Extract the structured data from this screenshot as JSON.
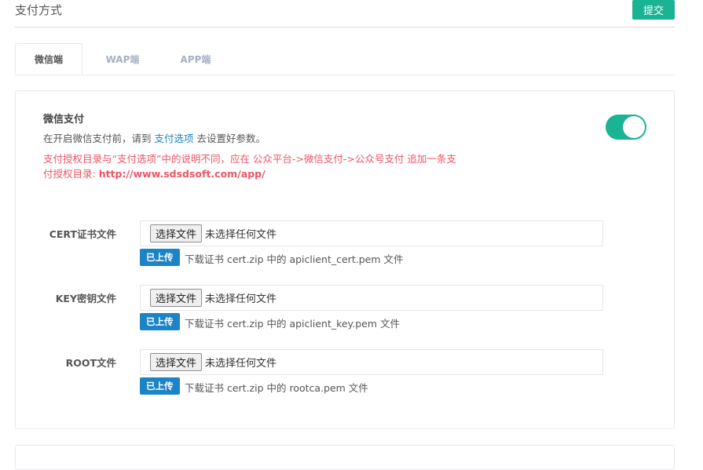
{
  "header": {
    "title": "支付方式",
    "submit_label": "提交"
  },
  "tabs": [
    {
      "label": "微信端",
      "active": true
    },
    {
      "label": "WAP端",
      "active": false
    },
    {
      "label": "APP端",
      "active": false
    }
  ],
  "wechat_pay": {
    "title": "微信支付",
    "desc_prefix": "在开启微信支付前，请到",
    "desc_link": "支付选项",
    "desc_suffix": "去设置好参数。",
    "warning_line1": "支付授权目录与“支付选项”中的说明不同，应在 公众平台->微信支付->公众号支付 追加一条支",
    "warning_line2_prefix": "付授权目录: ",
    "warning_url": "http://www.sdsdsoft.com/app/",
    "enabled": true
  },
  "files": [
    {
      "label": "CERT证书文件",
      "button": "选择文件",
      "status": "未选择任何文件",
      "badge": "已上传",
      "hint": "下载证书 cert.zip 中的 apiclient_cert.pem 文件"
    },
    {
      "label": "KEY密钥文件",
      "button": "选择文件",
      "status": "未选择任何文件",
      "badge": "已上传",
      "hint": "下载证书 cert.zip 中的 apiclient_key.pem 文件"
    },
    {
      "label": "ROOT文件",
      "button": "选择文件",
      "status": "未选择任何文件",
      "badge": "已上传",
      "hint": "下载证书 cert.zip 中的 rootca.pem 文件"
    }
  ],
  "colors": {
    "primary": "#1ab394",
    "link": "#1c84c6",
    "danger": "#ed5565"
  }
}
